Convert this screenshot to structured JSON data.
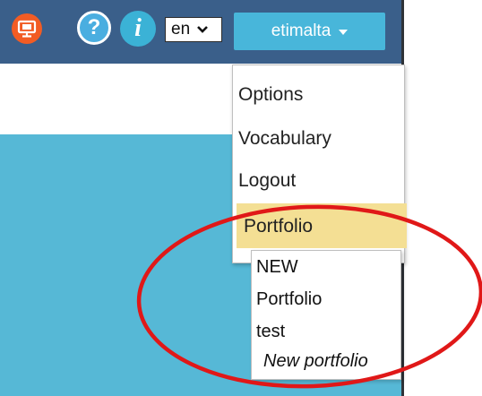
{
  "topbar": {
    "icons": [
      "screen-icon",
      "help-icon",
      "info-icon"
    ],
    "help_glyph": "?",
    "info_glyph": "i",
    "language": "en",
    "user_button_label": "etimalta"
  },
  "user_menu": {
    "items": [
      "Options",
      "Vocabulary",
      "Logout",
      "Portfolio"
    ],
    "highlighted": "Portfolio"
  },
  "portfolio_submenu": {
    "items": [
      "NEW",
      "Portfolio",
      "test"
    ],
    "new_label": "New portfolio"
  },
  "colors": {
    "topbar": "#3a5f8a",
    "content": "#56b8d6",
    "highlight": "#f4df94",
    "annotation": "#e01818"
  }
}
